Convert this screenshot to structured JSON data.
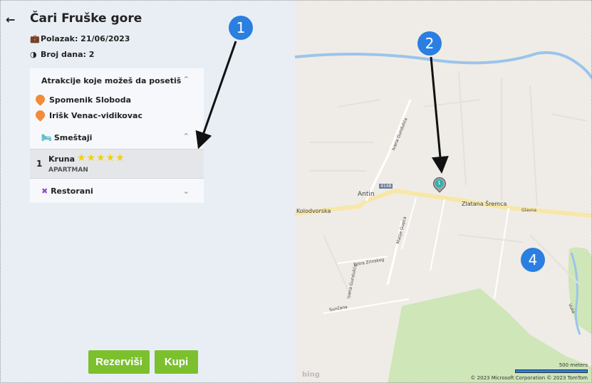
{
  "header": {
    "back_glyph": "🠔",
    "title": "Čari Fruške gore"
  },
  "trip": {
    "departure": "Polazak: 21/06/2023",
    "days": "Broj dana: 2"
  },
  "attractions": {
    "header": "Atrakcije koje možeš da posetiš",
    "items": [
      "Spomenik Sloboda",
      "Irišk Venac-vidikovac"
    ]
  },
  "accommodation": {
    "header": "Smeštaji",
    "items": [
      {
        "index": "1",
        "name": "Kruna",
        "rating": 5,
        "type": "APARTMAN"
      }
    ]
  },
  "restaurants": {
    "header": "Restorani"
  },
  "actions": {
    "reserve": "Rezerviši",
    "buy": "Kupi"
  },
  "callouts": [
    "1",
    "2",
    "4"
  ],
  "map": {
    "labels": {
      "kolodvorska": "Kolodvorska",
      "antin": "Antin",
      "zlatana": "Zlatana Šremca",
      "glavna": "Glavna",
      "road_no": "4148",
      "ivana_gundulica": "Ivana Gundulića",
      "matije_gupca": "Matije Gupca",
      "petra_zrinskog": "Petra Zrinskog",
      "suncana": "Sunčana",
      "vuka": "Vuka",
      "ivana_gundulica2": "Ivana Gundulića"
    },
    "marker_label": "1",
    "scale": "500 meters",
    "attribution": "© 2023 Microsoft Corporation   © 2023 TomTom",
    "logo": "bing"
  },
  "colors": {
    "accent_green": "#7cc02e",
    "callout_blue": "#2a7fe0",
    "pin_orange": "#f28b3a",
    "star_yellow": "#f5d000"
  }
}
